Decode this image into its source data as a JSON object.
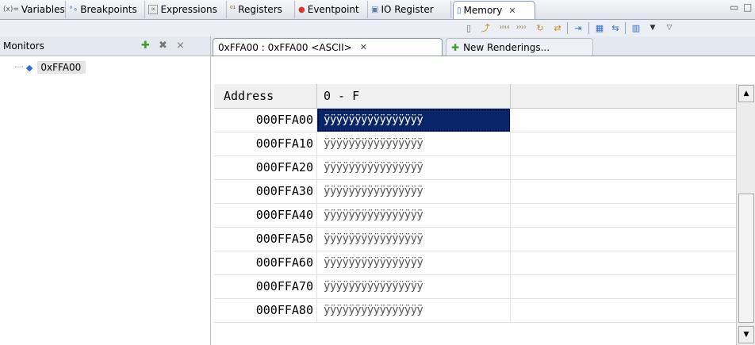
{
  "tabs": [
    {
      "label": "Variables",
      "icon": "variables-icon",
      "glyph": "(x)="
    },
    {
      "label": "Breakpoints",
      "icon": "breakpoints-icon",
      "glyph": "°∘"
    },
    {
      "label": "Expressions",
      "icon": "expressions-icon",
      "glyph": "∝"
    },
    {
      "label": "Registers",
      "icon": "registers-icon",
      "glyph": "⁰¹"
    },
    {
      "label": "Eventpoint",
      "icon": "eventpoint-icon",
      "glyph": "●"
    },
    {
      "label": "IO Register",
      "icon": "io-register-icon",
      "glyph": "▣"
    },
    {
      "label": "Memory",
      "icon": "memory-icon",
      "glyph": "▯",
      "active": true
    }
  ],
  "monitors": {
    "title": "Monitors",
    "items": [
      {
        "label": "0xFFA00"
      }
    ]
  },
  "renderings": {
    "active_tab": "0xFFA00 : 0xFFA00 <ASCII>",
    "new_tab": "New Renderings..."
  },
  "memory_table": {
    "headers": [
      "Address",
      "0 - F"
    ],
    "rows": [
      {
        "address": "000FFA00",
        "value": "ÿÿÿÿÿÿÿÿÿÿÿÿÿÿÿÿ",
        "selected": true
      },
      {
        "address": "000FFA10",
        "value": "ÿÿÿÿÿÿÿÿÿÿÿÿÿÿÿÿ"
      },
      {
        "address": "000FFA20",
        "value": "ÿÿÿÿÿÿÿÿÿÿÿÿÿÿÿÿ"
      },
      {
        "address": "000FFA30",
        "value": "ÿÿÿÿÿÿÿÿÿÿÿÿÿÿÿÿ"
      },
      {
        "address": "000FFA40",
        "value": "ÿÿÿÿÿÿÿÿÿÿÿÿÿÿÿÿ"
      },
      {
        "address": "000FFA50",
        "value": "ÿÿÿÿÿÿÿÿÿÿÿÿÿÿÿÿ"
      },
      {
        "address": "000FFA60",
        "value": "ÿÿÿÿÿÿÿÿÿÿÿÿÿÿÿÿ"
      },
      {
        "address": "000FFA70",
        "value": "ÿÿÿÿÿÿÿÿÿÿÿÿÿÿÿÿ"
      },
      {
        "address": "000FFA80",
        "value": "ÿÿÿÿÿÿÿÿÿÿÿÿÿÿÿÿ"
      }
    ]
  },
  "colors": {
    "selection": "#0a246a",
    "add_green": "#3c9c2e",
    "tree_diamond": "#2f6fc4"
  }
}
